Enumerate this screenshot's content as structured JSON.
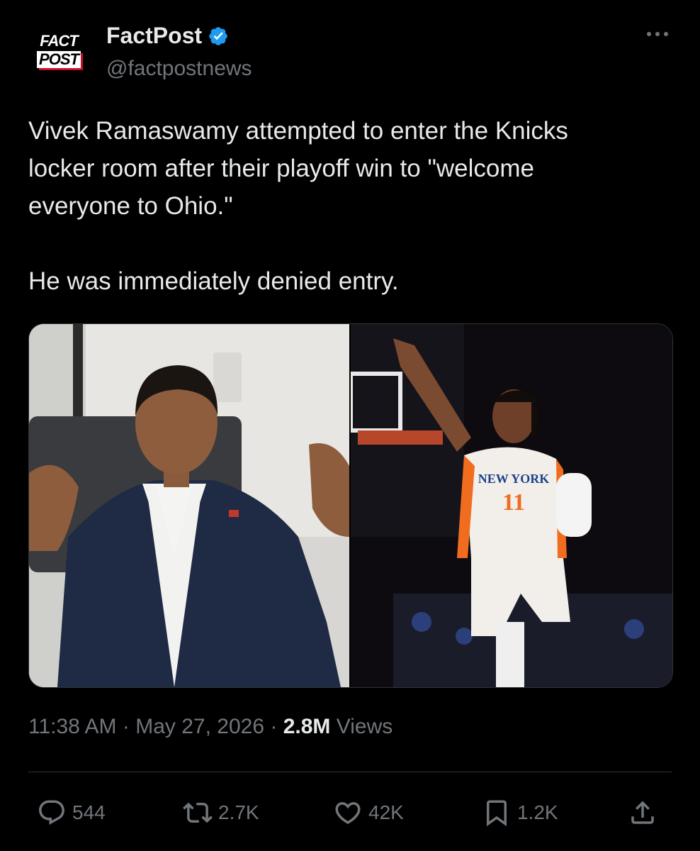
{
  "author": {
    "logo_line1": "FACT",
    "logo_line2": "POST",
    "display_name": "FactPost",
    "handle": "@factpostnews",
    "verified": true
  },
  "tweet": {
    "text": "Vivek Ramaswamy attempted to enter the Knicks\nlocker room after their playoff win to \"welcome\neveryone to Ohio.\"\n\nHe was immediately denied entry."
  },
  "meta": {
    "time": "11:38 AM",
    "separator": "·",
    "date": "May 27, 2026",
    "views_count": "2.8M",
    "views_label": "Views"
  },
  "actions": {
    "replies": "544",
    "reposts": "2.7K",
    "likes": "42K",
    "bookmarks": "1.2K"
  },
  "jersey": {
    "team": "NEW YORK",
    "number": "11"
  },
  "colors": {
    "background": "#000000",
    "text_primary": "#e7e9ea",
    "text_secondary": "#71767b",
    "verified_blue": "#1d9bf0",
    "divider": "#2f3336"
  },
  "icons": [
    "more-icon",
    "verified-badge-icon",
    "reply-icon",
    "repost-icon",
    "like-icon",
    "bookmark-icon",
    "share-icon"
  ]
}
